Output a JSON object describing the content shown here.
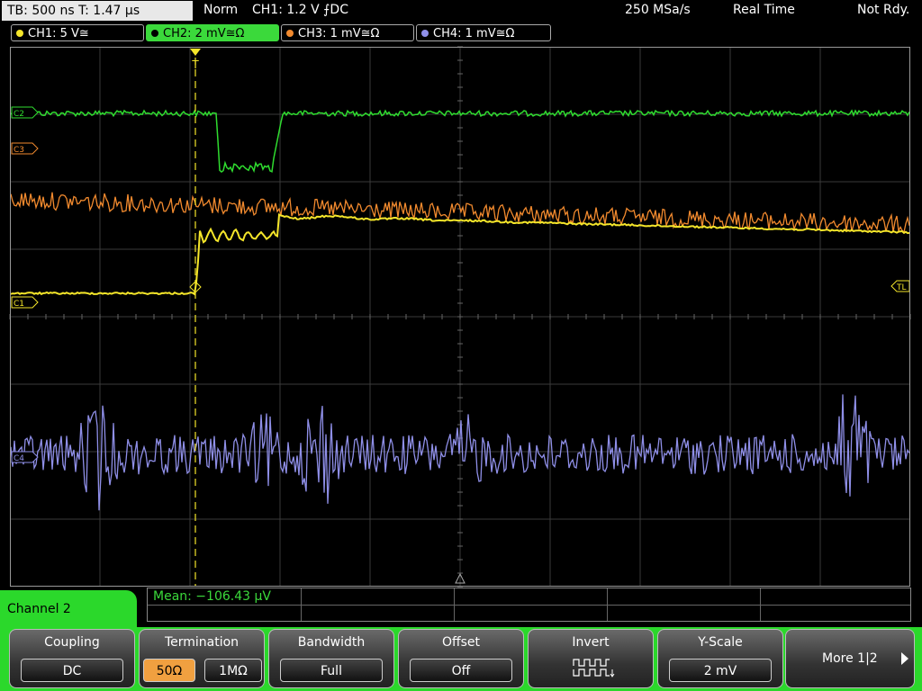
{
  "topbar": {
    "tb_label": "TB: 500 ns   T: 1.47 µs",
    "mode": "Norm",
    "trigger": "CH1: 1.2 V ⨍DC",
    "sample_rate": "250 MSa/s",
    "acq": "Real Time",
    "status": "Not Rdy."
  },
  "channels": [
    {
      "label": "CH1: 5 V≅",
      "color": "#f5e62a",
      "active": false
    },
    {
      "label": "CH2: 2 mV≅Ω",
      "color": "#3bd93b",
      "active": true
    },
    {
      "label": "CH3: 1 mV≅Ω",
      "color": "#f28a2e",
      "active": false
    },
    {
      "label": "CH4: 1 mV≅Ω",
      "color": "#8f8fe8",
      "active": false
    }
  ],
  "markers": {
    "c2": "C2",
    "c3": "C3",
    "c1": "C1",
    "c4": "C4",
    "tl": "TL",
    "trigger": "T"
  },
  "measurement": {
    "label": "Mean: −106.43 µV"
  },
  "channel_tab": "Channel 2",
  "softkeys": {
    "coupling": {
      "label": "Coupling",
      "value": "DC"
    },
    "termination": {
      "label": "Termination",
      "opt1": "50Ω",
      "opt2": "1MΩ"
    },
    "bandwidth": {
      "label": "Bandwidth",
      "value": "Full"
    },
    "offset": {
      "label": "Offset",
      "value": "Off"
    },
    "invert": {
      "label": "Invert"
    },
    "yscale": {
      "label": "Y-Scale",
      "value": "2 mV"
    },
    "more": {
      "label": "More 1|2"
    }
  },
  "colors": {
    "ch1": "#f5e62a",
    "ch2": "#3bd93b",
    "ch3": "#f28a2e",
    "ch4": "#8f8fe8",
    "accent": "#2bd82b"
  }
}
